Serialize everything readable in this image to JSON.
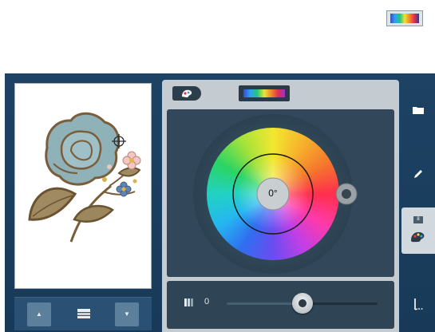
{
  "colors": {
    "screen_bg": "#1d4264",
    "panel_bg": "#c4ccd2",
    "wheel_bg": "#32485a",
    "accent_white": "#ffffff"
  },
  "top_toolbar": {
    "icon": "color-palette-strip-icon"
  },
  "preview": {
    "design": "embroidery-rose-design",
    "cursor_icon": "crosshair-icon"
  },
  "preview_nav": {
    "prev_icon": "triangle-up-icon",
    "next_icon": "triangle-down-icon",
    "center_icon": "layer-stack-icon"
  },
  "panel": {
    "tabs": [
      {
        "icon": "color-wheel-tab-icon",
        "active": true
      },
      {
        "icon": "color-strip-tab-icon",
        "active": false
      }
    ],
    "wheel": {
      "angle_label": "0°",
      "hue_rotation_deg": 0
    },
    "slider": {
      "icon": "brightness-icon",
      "value_label": "0",
      "value": 0.5
    }
  },
  "sidebar": {
    "items": [
      {
        "icon": "folder-icon",
        "active": false
      },
      {
        "icon": "pencil-icon",
        "active": false
      },
      {
        "icon": "palette-icon",
        "badge": "8",
        "active": true
      },
      {
        "icon": "needle-thread-icon",
        "active": false
      }
    ]
  }
}
